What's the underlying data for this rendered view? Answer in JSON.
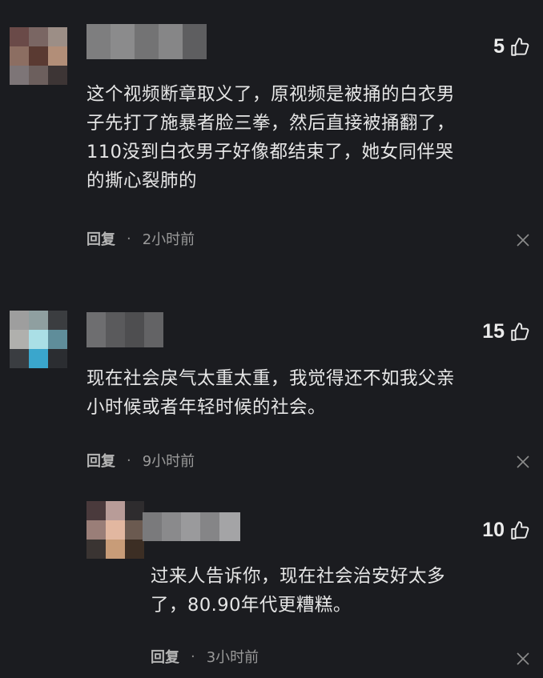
{
  "comments": [
    {
      "likes": "5",
      "text": "这个视频断章取义了，原视频是被捅的白衣男\n子先打了施暴者脸三拳，然后直接被捅翻了，\n110没到白衣男子好像都结束了，她女同伴哭\n的撕心裂肺的",
      "reply_label": "回复",
      "separator": "·",
      "time": "2小时前"
    },
    {
      "likes": "15",
      "text": "现在社会戾气太重太重，我觉得还不如我父亲\n小时候或者年轻时候的社会。",
      "reply_label": "回复",
      "separator": "·",
      "time": "9小时前"
    },
    {
      "likes": "10",
      "text": "过来人告诉你，现在社会治安好太多\n了，80.90年代更糟糕。",
      "reply_label": "回复",
      "separator": "·",
      "time": "3小时前"
    }
  ],
  "icons": {
    "like": "thumbs-up-icon",
    "close": "close-icon"
  },
  "colors": {
    "background": "#1b1c20",
    "text": "#e6e6e6",
    "meta": "#9a9a9a"
  }
}
